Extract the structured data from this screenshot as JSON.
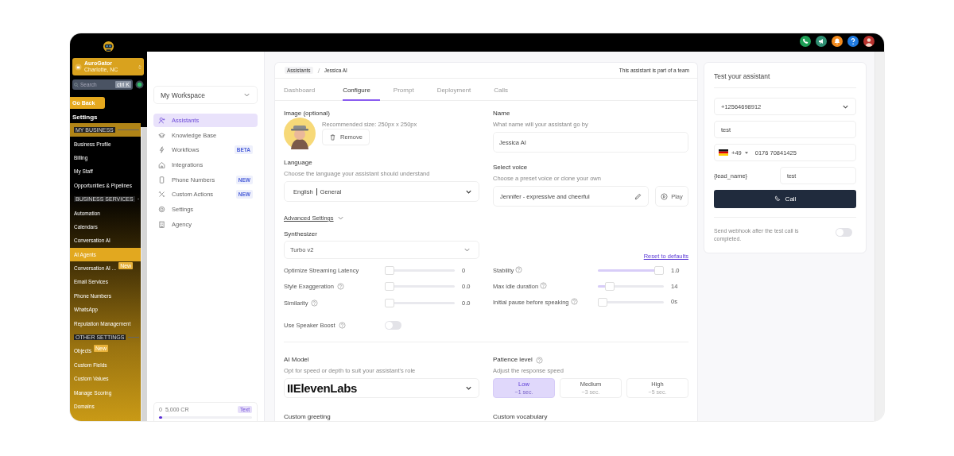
{
  "topbar": {
    "icons": [
      {
        "kind": "phone",
        "color": "#1e9e55"
      },
      {
        "kind": "megaphone",
        "color": "#2f8f72"
      },
      {
        "kind": "bell",
        "color": "#f28a1c"
      },
      {
        "kind": "help",
        "color": "#1f7ae0"
      },
      {
        "kind": "avatar",
        "color": "#b8322e"
      }
    ]
  },
  "sidebar": {
    "account": {
      "name": "AuroGator",
      "location": "Charlotte, NC"
    },
    "search": {
      "placeholder": "Search",
      "shortcut": "ctrl K"
    },
    "back_button": "Go Back",
    "title": "Settings",
    "items": [
      {
        "kind": "header",
        "label": "MY BUSINESS",
        "highlighted": true
      },
      {
        "kind": "item",
        "label": "Business Profile",
        "selected": false
      },
      {
        "kind": "item",
        "label": "Billing",
        "selected": false
      },
      {
        "kind": "item",
        "label": "My Staff",
        "selected": false
      },
      {
        "kind": "item",
        "label": "Opportunities & Pipelines",
        "selected": false
      },
      {
        "kind": "header",
        "label": "BUSINESS SERVICES",
        "highlighted": false
      },
      {
        "kind": "item",
        "label": "Automation",
        "selected": false
      },
      {
        "kind": "item",
        "label": "Calendars",
        "selected": false
      },
      {
        "kind": "item",
        "label": "Conversation AI",
        "selected": false
      },
      {
        "kind": "item",
        "label": "AI Agents",
        "selected": true
      },
      {
        "kind": "item",
        "label": "Conversation AI ...",
        "badge": "New",
        "selected": false
      },
      {
        "kind": "item",
        "label": "Email Services",
        "selected": false
      },
      {
        "kind": "item",
        "label": "Phone Numbers",
        "selected": false
      },
      {
        "kind": "item",
        "label": "WhatsApp",
        "selected": false
      },
      {
        "kind": "item",
        "label": "Reputation Management",
        "selected": false
      },
      {
        "kind": "header",
        "label": "OTHER SETTINGS",
        "highlighted": false
      },
      {
        "kind": "item",
        "label": "Objects",
        "badge": "New",
        "selected": false
      },
      {
        "kind": "item",
        "label": "Custom Fields",
        "selected": false
      },
      {
        "kind": "item",
        "label": "Custom Values",
        "selected": false
      },
      {
        "kind": "item",
        "label": "Manage Scoring",
        "selected": false
      },
      {
        "kind": "item",
        "label": "Domains",
        "selected": false
      }
    ]
  },
  "workspace": {
    "selector": "My Workspace",
    "items": [
      {
        "kind": "user-plus",
        "label": "Assistants",
        "selected": true
      },
      {
        "kind": "cap",
        "label": "Knowledge Base",
        "selected": false
      },
      {
        "kind": "bolt",
        "label": "Workflows",
        "badge": "BETA",
        "selected": false
      },
      {
        "kind": "house",
        "label": "Integrations",
        "selected": false
      },
      {
        "kind": "phone",
        "label": "Phone Numbers",
        "badge": "NEW",
        "selected": false
      },
      {
        "kind": "tools",
        "label": "Custom Actions",
        "badge": "NEW",
        "selected": false
      },
      {
        "kind": "gear",
        "label": "Settings",
        "selected": false
      },
      {
        "kind": "building",
        "label": "Agency",
        "selected": false
      }
    ],
    "credits": {
      "used": "0",
      "total": "5,000 CR",
      "badge": "Text",
      "level": 0.03
    }
  },
  "assistant": {
    "breadcrumb": [
      "Assistants",
      "Jessica AI"
    ],
    "team_note": "This assistant is part of a team",
    "tabs": [
      {
        "label": "Dashboard",
        "selected": false
      },
      {
        "label": "Configure",
        "selected": true
      },
      {
        "label": "Prompt",
        "selected": false
      },
      {
        "label": "Deployment",
        "selected": false
      },
      {
        "label": "Calls",
        "selected": false
      }
    ],
    "image": {
      "label": "Image (optional)",
      "hint": "Recommended size: 250px x 250px",
      "remove_button": "Remove"
    },
    "name": {
      "label": "Name",
      "description": "What name will your assistant go by",
      "value": "Jessica AI"
    },
    "language": {
      "label": "Language",
      "description": "Choose the language your assistant should understand",
      "value": [
        "English",
        "General"
      ]
    },
    "voice": {
      "label": "Select voice",
      "description": "Choose a preset voice or clone your own",
      "value": "Jennifer - expressive and cheerful",
      "play_button": "Play"
    },
    "advanced_toggle": "Advanced Settings",
    "synthesizer": {
      "label": "Synthesizer",
      "value": "Turbo v2"
    },
    "reset_link": "Reset to defaults",
    "sliders_left": [
      {
        "label": "Optimize Streaming Latency",
        "help": false,
        "level": 0,
        "reading": "0"
      },
      {
        "label": "Style Exaggeration",
        "help": true,
        "level": 0,
        "reading": "0.0"
      },
      {
        "label": "Similarity",
        "help": true,
        "level": 0,
        "reading": "0.0"
      }
    ],
    "sliders_right": [
      {
        "label": "Stability",
        "help": true,
        "level": 1,
        "reading": "1.0"
      },
      {
        "label": "Max idle duration",
        "help": true,
        "level": 0.12,
        "reading": "14"
      },
      {
        "label": "Initial pause before speaking",
        "help": true,
        "level": 0,
        "reading": "0s"
      }
    ],
    "speaker_boost": {
      "label": "Use Speaker Boost",
      "help": true,
      "on": false
    },
    "ai_model": {
      "label": "AI Model",
      "description": "Opt for speed or depth to suit your assistant's role",
      "value": "IIElevenLabs"
    },
    "patience": {
      "label": "Patience level",
      "description": "Adjust the response speed",
      "options": [
        {
          "label": "Low",
          "sub": "~1 sec.",
          "selected": true
        },
        {
          "label": "Medium",
          "sub": "~3 sec.",
          "selected": false
        },
        {
          "label": "High",
          "sub": "~5 sec.",
          "selected": false
        }
      ]
    },
    "custom_greeting": "Custom greeting",
    "custom_vocabulary": "Custom vocabulary"
  },
  "test_panel": {
    "title": "Test your assistant",
    "from_number": "+12564698912",
    "name_value": "test",
    "country_code": "+49",
    "phone_value": "0176 70841425",
    "variable_label": "{lead_name}",
    "variable_value": "test",
    "call_button": "Call",
    "webhook_label": "Send webhook after the test call is completed.",
    "webhook_on": false
  }
}
